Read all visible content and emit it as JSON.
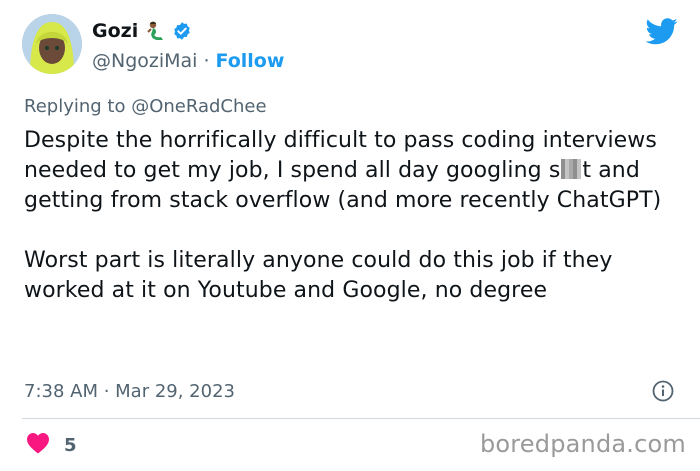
{
  "author": {
    "display_name": "Gozi",
    "handle": "@NgoziMai",
    "separator": "·",
    "follow_label": "Follow"
  },
  "reply": {
    "prefix": "Replying to",
    "mention": "@OneRadChee"
  },
  "tweet": {
    "text_part1": "Despite the horrifically difficult to pass coding interviews needed to get my job, I spend all day googling s",
    "text_part2": "t and getting from stack overflow (and more recently ChatGPT)\n\nWorst part is literally anyone could do this job if they worked at it on Youtube and Google, no degree"
  },
  "meta": {
    "timestamp": "7:38 AM · Mar 29, 2023"
  },
  "engagement": {
    "like_count": "5"
  },
  "watermark": "boredpanda.com",
  "colors": {
    "accent": "#1d9bf0",
    "like": "#f91880",
    "muted": "#536471"
  }
}
